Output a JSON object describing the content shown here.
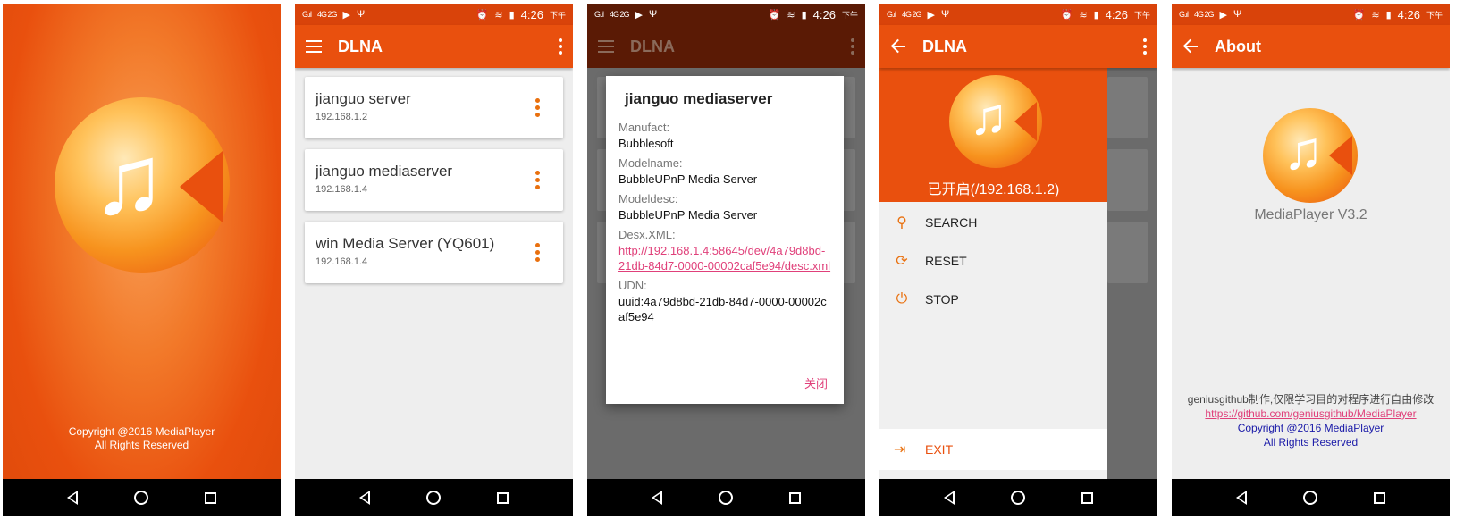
{
  "status_bar": {
    "signal1": "G.ıl",
    "signal2": "4G 2G",
    "time": "4:26",
    "ampm": "下午"
  },
  "splash": {
    "copyright_line1": "Copyright @2016 MediaPlayer",
    "copyright_line2": "All Rights Reserved"
  },
  "dlna_list": {
    "title": "DLNA",
    "devices": [
      {
        "name": "jianguo  server",
        "ip": "192.168.1.2"
      },
      {
        "name": "jianguo mediaserver",
        "ip": "192.168.1.4"
      },
      {
        "name": "win  Media Server (YQ601)",
        "ip": "192.168.1.4"
      }
    ]
  },
  "device_dialog": {
    "title": "jianguo mediaserver",
    "manufact_label": "Manufact:",
    "manufact_value": "Bubblesoft",
    "modelname_label": "Modelname:",
    "modelname_value": "BubbleUPnP Media Server",
    "modeldesc_label": "Modeldesc:",
    "modeldesc_value": "BubbleUPnP Media Server",
    "desc_xml_label": "Desx.XML:",
    "desc_xml_value": "http://192.168.1.4:58645/dev/4a79d8bd-21db-84d7-0000-00002caf5e94/desc.xml",
    "udn_label": "UDN:",
    "udn_value": "uuid:4a79d8bd-21db-84d7-0000-00002caf5e94",
    "close_label": "关闭"
  },
  "drawer": {
    "title": "DLNA",
    "status": "已开启(/192.168.1.2)",
    "items": [
      {
        "label": "SEARCH",
        "icon": "search-icon"
      },
      {
        "label": "RESET",
        "icon": "refresh-icon"
      },
      {
        "label": "STOP",
        "icon": "power-icon"
      }
    ],
    "exit_label": "EXIT"
  },
  "about": {
    "title": "About",
    "version": "MediaPlayer V3.2",
    "made_by": "geniusgithub制作,仅限学习目的对程序进行自由修改",
    "github_link": "https://github.com/geniusgithub/MediaPlayer",
    "copyright_line1": "Copyright @2016 MediaPlayer",
    "copyright_line2": "All Rights Reserved"
  },
  "colors": {
    "primary": "#e9500e",
    "accent_link": "#e0407a",
    "icon_orange": "#e9700e",
    "copyright_blue": "#1a1aa8"
  }
}
